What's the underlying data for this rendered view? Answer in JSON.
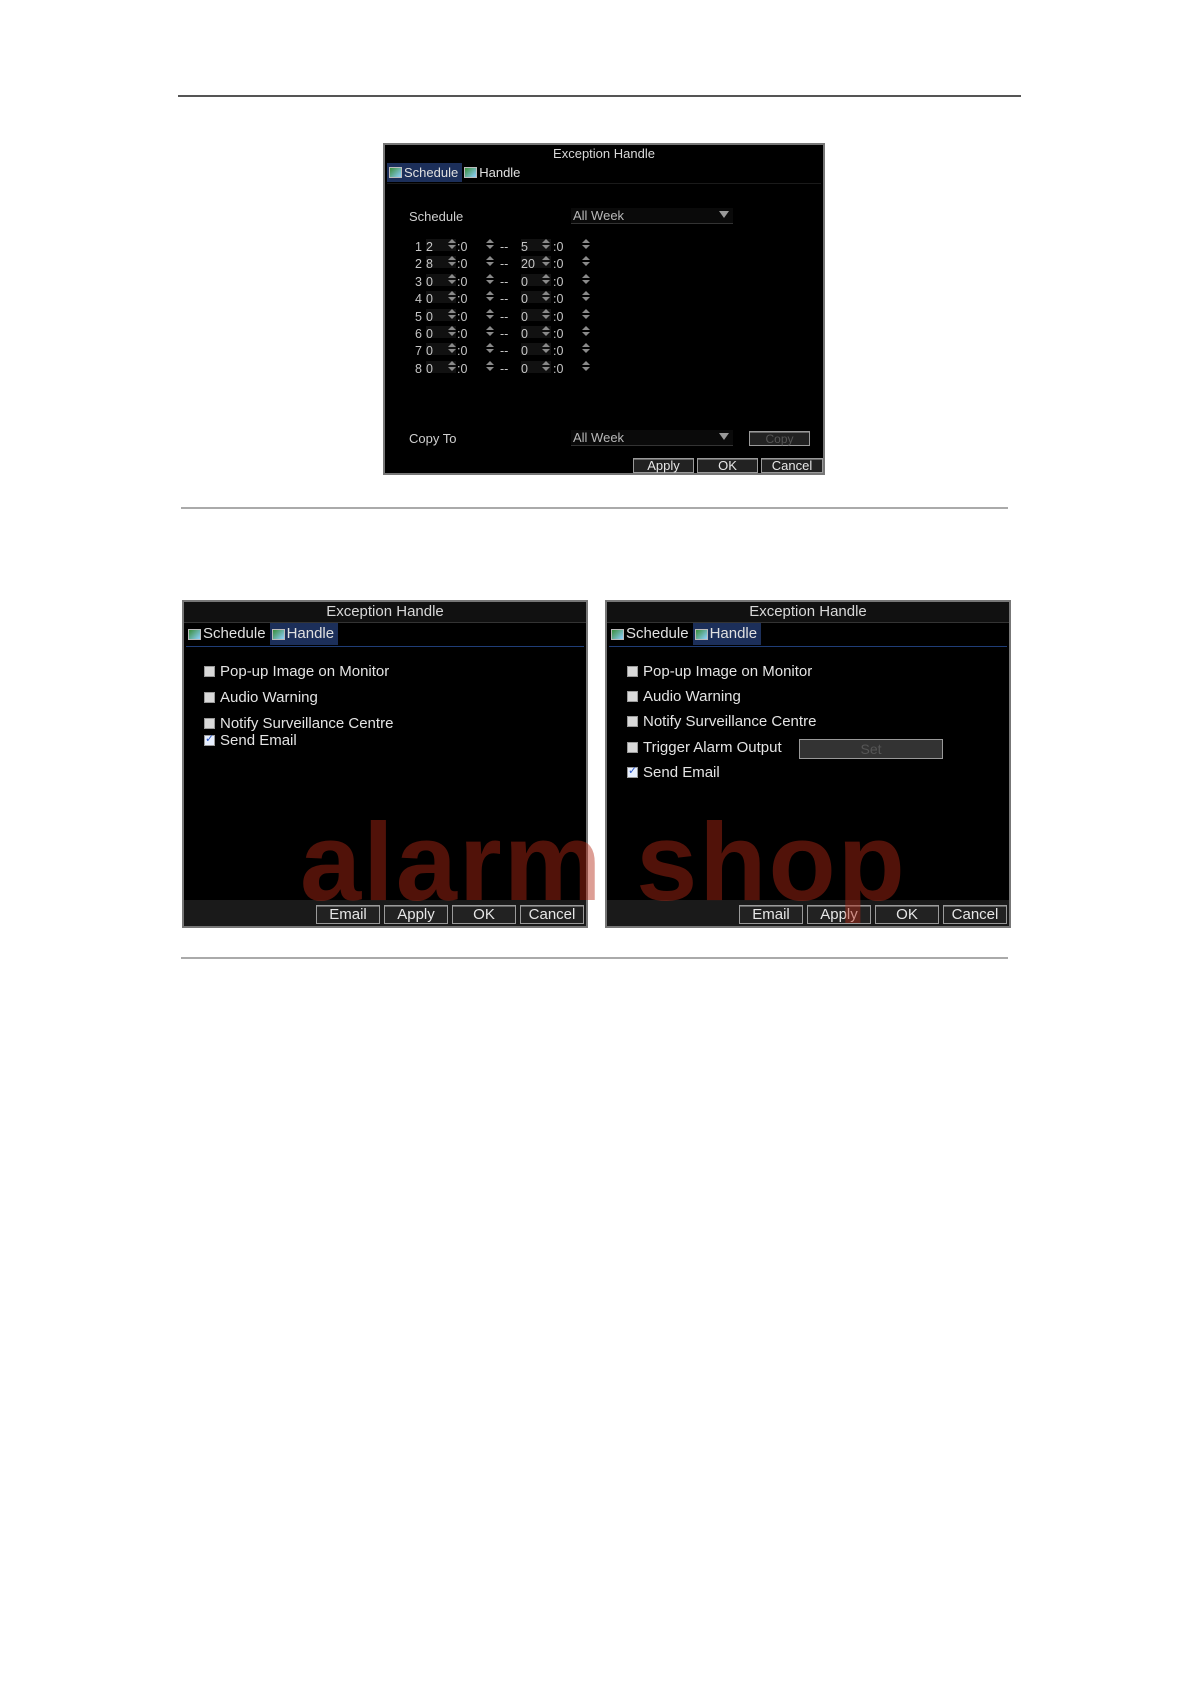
{
  "schedule_dialog": {
    "title": "Exception Handle",
    "tabs": [
      {
        "label": "Schedule",
        "active": true
      },
      {
        "label": "Handle",
        "active": false
      }
    ],
    "schedule_label": "Schedule",
    "schedule_value": "All Week",
    "rows": [
      {
        "n": "1",
        "sh": "2",
        "sm": ":0",
        "dash": "--",
        "eh": "5",
        "em": ":0"
      },
      {
        "n": "2",
        "sh": "8",
        "sm": ":0",
        "dash": "--",
        "eh": "20",
        "em": ":0"
      },
      {
        "n": "3",
        "sh": "0",
        "sm": ":0",
        "dash": "--",
        "eh": "0",
        "em": ":0"
      },
      {
        "n": "4",
        "sh": "0",
        "sm": ":0",
        "dash": "--",
        "eh": "0",
        "em": ":0"
      },
      {
        "n": "5",
        "sh": "0",
        "sm": ":0",
        "dash": "--",
        "eh": "0",
        "em": ":0"
      },
      {
        "n": "6",
        "sh": "0",
        "sm": ":0",
        "dash": "--",
        "eh": "0",
        "em": ":0"
      },
      {
        "n": "7",
        "sh": "0",
        "sm": ":0",
        "dash": "--",
        "eh": "0",
        "em": ":0"
      },
      {
        "n": "8",
        "sh": "0",
        "sm": ":0",
        "dash": "--",
        "eh": "0",
        "em": ":0"
      }
    ],
    "copy_to_label": "Copy To",
    "copy_to_value": "All Week",
    "copy_label": "Copy",
    "apply_label": "Apply",
    "ok_label": "OK",
    "cancel_label": "Cancel"
  },
  "handle_dialog_left": {
    "title": "Exception Handle",
    "tabs": [
      {
        "label": "Schedule",
        "active": false
      },
      {
        "label": "Handle",
        "active": true
      }
    ],
    "options": [
      {
        "label": "Pop-up Image on Monitor",
        "checked": false
      },
      {
        "label": "Audio Warning",
        "checked": false
      },
      {
        "label": "Notify Surveillance Centre",
        "checked": false
      },
      {
        "label": "Send Email",
        "checked": true
      }
    ],
    "email_label": "Email",
    "apply_label": "Apply",
    "ok_label": "OK",
    "cancel_label": "Cancel"
  },
  "handle_dialog_right": {
    "title": "Exception Handle",
    "tabs": [
      {
        "label": "Schedule",
        "active": false
      },
      {
        "label": "Handle",
        "active": true
      }
    ],
    "options": [
      {
        "label": "Pop-up Image on Monitor",
        "checked": false
      },
      {
        "label": "Audio Warning",
        "checked": false
      },
      {
        "label": "Notify Surveillance Centre",
        "checked": false
      },
      {
        "label": "Trigger Alarm Output",
        "checked": false
      },
      {
        "label": "Send Email",
        "checked": true
      }
    ],
    "set_label": "Set",
    "email_label": "Email",
    "apply_label": "Apply",
    "ok_label": "OK",
    "cancel_label": "Cancel"
  },
  "watermark": "alarm shop",
  "colors": {
    "dialog_bg": "#000000",
    "active_tab": "#1c2f5a",
    "watermark": "#b42814",
    "check": "#2b57c8"
  }
}
